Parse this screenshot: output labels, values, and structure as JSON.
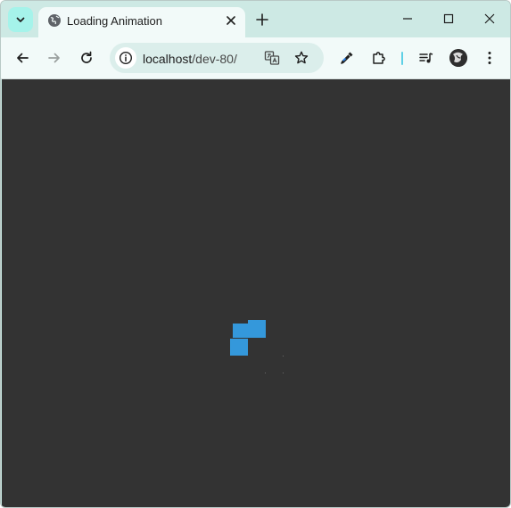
{
  "browser": {
    "tab": {
      "title": "Loading Animation"
    },
    "address_bar": {
      "host": "localhost",
      "path": "/dev-80/"
    }
  },
  "icons": {
    "tab_search": "chevron-down-icon",
    "favicon": "globe-icon",
    "tab_close": "close-icon",
    "new_tab": "plus-icon",
    "minimize": "minimize-icon",
    "maximize": "maximize-icon",
    "close_window": "close-icon",
    "back": "arrow-left-icon",
    "forward": "arrow-right-icon",
    "reload": "reload-icon",
    "site_info": "info-icon",
    "translate": "translate-icon",
    "bookmark": "star-icon",
    "eyedropper": "eyedropper-icon",
    "extensions": "puzzle-icon",
    "media": "playlist-icon",
    "profile": "avatar-icon",
    "menu": "kebab-menu-icon"
  },
  "page": {
    "background": "#333333",
    "loader_color": "#3498db"
  }
}
